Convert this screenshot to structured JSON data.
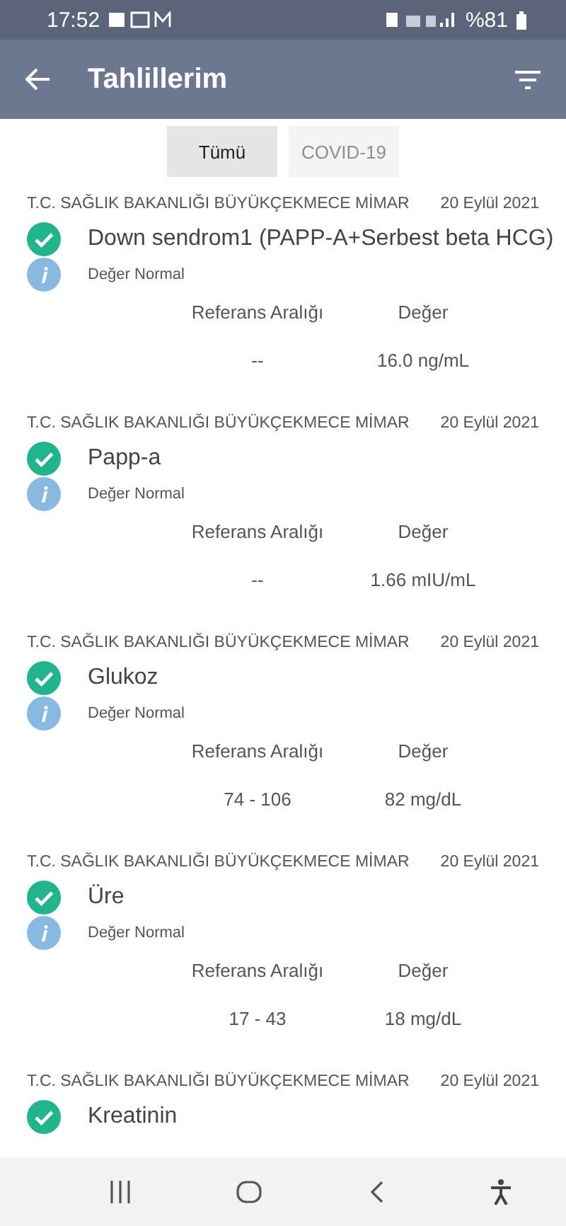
{
  "status_bar": {
    "time": "17:52",
    "battery": "%81"
  },
  "app_bar": {
    "title": "Tahlillerim"
  },
  "tabs": [
    {
      "label": "Tümü",
      "selected": true
    },
    {
      "label": "COVID-19",
      "selected": false
    }
  ],
  "results": [
    {
      "hospital": "T.C. SAĞLIK BAKANLIĞI BÜYÜKÇEKMECE MİMAR",
      "date": "20 Eylül 2021",
      "name": "Down sendrom1 (PAPP-A+Serbest beta HCG)",
      "note": "Değer Normal",
      "ref_label": "Referans Aralığı",
      "value_label": "Değer",
      "ref": "--",
      "value": "16.0 ng/mL"
    },
    {
      "hospital": "T.C. SAĞLIK BAKANLIĞI BÜYÜKÇEKMECE MİMAR",
      "date": "20 Eylül 2021",
      "name": "Papp-a",
      "note": "Değer Normal",
      "ref_label": "Referans Aralığı",
      "value_label": "Değer",
      "ref": "--",
      "value": "1.66 mIU/mL"
    },
    {
      "hospital": "T.C. SAĞLIK BAKANLIĞI BÜYÜKÇEKMECE MİMAR",
      "date": "20 Eylül 2021",
      "name": "Glukoz",
      "note": "Değer Normal",
      "ref_label": "Referans Aralığı",
      "value_label": "Değer",
      "ref": "74 - 106",
      "value": "82 mg/dL"
    },
    {
      "hospital": "T.C. SAĞLIK BAKANLIĞI BÜYÜKÇEKMECE MİMAR",
      "date": "20 Eylül 2021",
      "name": "Üre",
      "note": "Değer Normal",
      "ref_label": "Referans Aralığı",
      "value_label": "Değer",
      "ref": "17 - 43",
      "value": "18 mg/dL"
    },
    {
      "hospital": "T.C. SAĞLIK BAKANLIĞI BÜYÜKÇEKMECE MİMAR",
      "date": "20 Eylül 2021",
      "name": "Kreatinin"
    }
  ]
}
